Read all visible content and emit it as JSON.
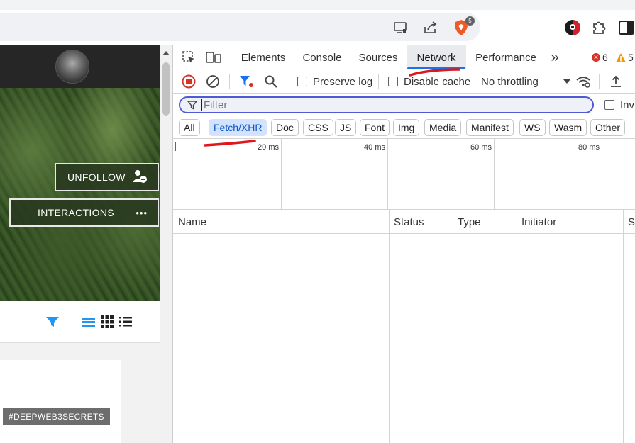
{
  "browser": {
    "brave_badge_count": "5"
  },
  "page": {
    "unfollow_label": "UNFOLLOW",
    "interactions_label": "INTERACTIONS",
    "interactions_dots": "•••",
    "hashtag": "#DEEPWEB3SECRETS"
  },
  "devtools": {
    "tabs": [
      {
        "label": "Elements"
      },
      {
        "label": "Console"
      },
      {
        "label": "Sources"
      },
      {
        "label": "Network"
      },
      {
        "label": "Performance"
      }
    ],
    "more_tabs": "»",
    "error_count": "6",
    "warning_count": "5",
    "toolbar": {
      "preserve_log": "Preserve log",
      "disable_cache": "Disable cache",
      "throttling": "No throttling"
    },
    "filter": {
      "placeholder": "Filter",
      "invert_label": "Inv"
    },
    "types": [
      "All",
      "Fetch/XHR",
      "Doc",
      "CSS",
      "JS",
      "Font",
      "Img",
      "Media",
      "Manifest",
      "WS",
      "Wasm",
      "Other"
    ],
    "active_type": "Fetch/XHR",
    "timeline_labels": [
      "20 ms",
      "40 ms",
      "60 ms",
      "80 ms"
    ],
    "columns": [
      "Name",
      "Status",
      "Type",
      "Initiator",
      "Si"
    ],
    "colors": {
      "accent": "#1a73e8",
      "active_chip_bg": "#d3e3fd",
      "filter_border": "#4f5bd5",
      "annotation": "#e0161b"
    }
  }
}
